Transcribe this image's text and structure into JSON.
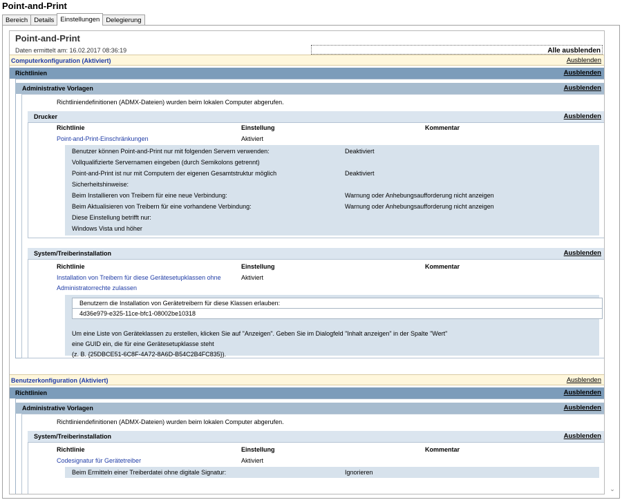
{
  "window": {
    "title": "Point-and-Print"
  },
  "tabs": [
    {
      "label": "Bereich"
    },
    {
      "label": "Details"
    },
    {
      "label": "Einstellungen"
    },
    {
      "label": "Delegierung"
    }
  ],
  "report": {
    "title": "Point-and-Print",
    "date": "Daten ermittelt am: 16.02.2017 08:36:19",
    "hide_all": "Alle ausblenden",
    "hide_label": "Ausblenden"
  },
  "computer": {
    "header": "Computerkonfiguration (Aktiviert)",
    "policies": "Richtlinien",
    "admin_templates": "Administrative Vorlagen",
    "admx_note": "Richtliniendefinitionen (ADMX-Dateien) wurden beim lokalen Computer abgerufen.",
    "printer": {
      "header": "Drucker",
      "col_policy": "Richtlinie",
      "col_setting": "Einstellung",
      "col_comment": "Kommentar",
      "policy_name": "Point-and-Print-Einschränkungen",
      "policy_value": "Aktiviert",
      "details": [
        {
          "label": "Benutzer können Point-and-Print nur mit folgenden Servern verwenden:",
          "value": "Deaktiviert"
        },
        {
          "label": "Vollqualifizierte Servernamen eingeben (durch Semikolons getrennt)",
          "value": ""
        },
        {
          "label": "Point-and-Print ist nur mit Computern der eigenen Gesamtstruktur möglich",
          "value": "Deaktiviert"
        },
        {
          "label": "Sicherheitshinweise:",
          "value": ""
        },
        {
          "label": "Beim Installieren von Treibern für eine neue Verbindung:",
          "value": "Warnung oder Anhebungsaufforderung nicht anzeigen"
        },
        {
          "label": "Beim Aktualisieren von Treibern für eine vorhandene Verbindung:",
          "value": "Warnung oder Anhebungsaufforderung nicht anzeigen"
        },
        {
          "label": "Diese Einstellung betrifft nur:",
          "value": ""
        },
        {
          "label": "Windows Vista und höher",
          "value": ""
        }
      ]
    },
    "driver_install": {
      "header": "System/Treiberinstallation",
      "col_policy": "Richtlinie",
      "col_setting": "Einstellung",
      "col_comment": "Kommentar",
      "policy_name_line1": "Installation von Treibern für diese Gerätesetupklassen ohne",
      "policy_name_line2": "Administratorrechte zulassen",
      "policy_value": "Aktiviert",
      "table_header": "Benutzern die Installation von Gerätetreibern für diese Klassen erlauben:",
      "table_value": "4d36e979-e325-11ce-bfc1-08002be10318",
      "help": [
        "Um eine Liste von Geräteklassen zu erstellen, klicken Sie auf \"Anzeigen\". Geben Sie im Dialogfeld \"Inhalt anzeigen\" in der Spalte \"Wert\"",
        "eine GUID ein, die für eine Gerätesetupklasse steht",
        "(z. B. {25DBCE51-6C8F-4A72-8A6D-B54C2B4FC835})."
      ]
    }
  },
  "user": {
    "header": "Benutzerkonfiguration (Aktiviert)",
    "policies": "Richtlinien",
    "admin_templates": "Administrative Vorlagen",
    "admx_note": "Richtliniendefinitionen (ADMX-Dateien) wurden beim lokalen Computer abgerufen.",
    "driver_install": {
      "header": "System/Treiberinstallation",
      "col_policy": "Richtlinie",
      "col_setting": "Einstellung",
      "col_comment": "Kommentar",
      "policy_name": "Codesignatur für Gerätetreiber",
      "policy_value": "Aktiviert",
      "detail_label": "Beim Ermitteln einer Treiberdatei ohne digitale Signatur:",
      "detail_value": "Ignorieren"
    }
  },
  "icons": {
    "scroll_down": "chevron-down-icon"
  }
}
